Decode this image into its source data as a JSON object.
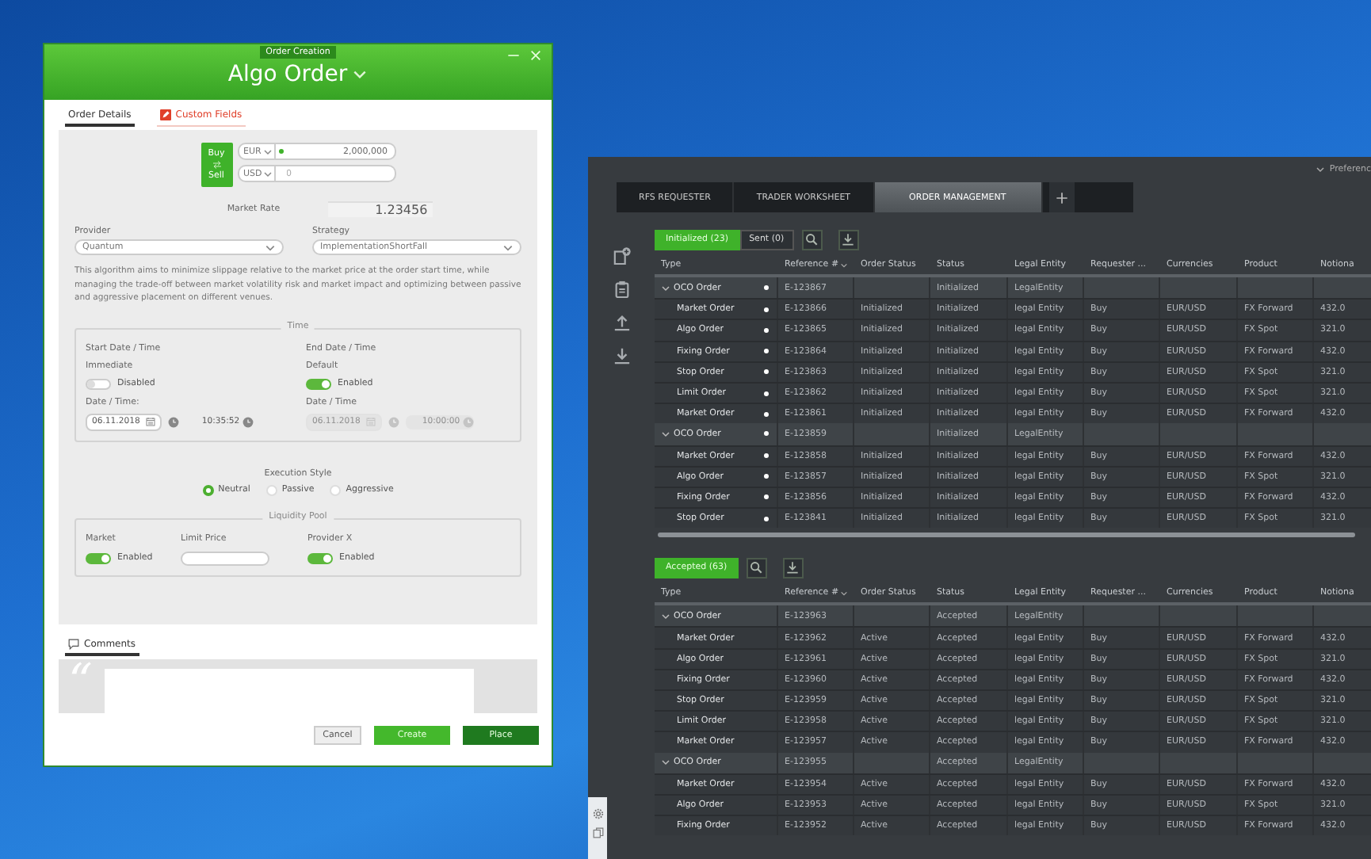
{
  "dialog": {
    "badge": "Order Creation",
    "title": "Algo Order",
    "tabs": [
      {
        "label": "Order Details",
        "selected": true,
        "kind": "plain"
      },
      {
        "label": "Custom Fields",
        "selected": false,
        "kind": "flagged"
      }
    ],
    "buy_sell": {
      "top": "Buy",
      "bottom": "Sell"
    },
    "currencies": [
      {
        "code": "EUR",
        "value": "2,000,000",
        "active": true
      },
      {
        "code": "USD",
        "placeholder": "0",
        "active": false
      }
    ],
    "market_rate": {
      "label": "Market Rate",
      "value": "1.23456"
    },
    "selects": [
      {
        "label": "Provider",
        "value": "Quantum"
      },
      {
        "label": "Strategy",
        "value": "ImplementationShortFall"
      }
    ],
    "description": "This algorithm aims to minimize slippage relative to the market price at the order start time, while managing the trade-off between market volatility risk and market impact and optimizing between passive and aggressive placement on different venues.",
    "time": {
      "legend": "Time",
      "columns": [
        {
          "heading": "Start Date / Time",
          "mode": "Immediate",
          "toggle_on": false,
          "toggle_label": "Disabled",
          "datetime_label": "Date / Time:",
          "date": "06.11.2018",
          "time": "10:35:52",
          "disabled": false
        },
        {
          "heading": "End Date / Time",
          "mode": "Default",
          "toggle_on": true,
          "toggle_label": "Enabled",
          "datetime_label": "Date / Time",
          "date": "06.11.2018",
          "time": "10:00:00",
          "disabled": true
        }
      ]
    },
    "execution_style": {
      "label": "Execution Style",
      "options": [
        {
          "label": "Neutral",
          "selected": true
        },
        {
          "label": "Passive",
          "selected": false
        },
        {
          "label": "Aggressive",
          "selected": false
        }
      ]
    },
    "liquidity_pool": {
      "legend": "Liquidity Pool",
      "items": [
        {
          "kind": "toggle",
          "label": "Market",
          "on": true,
          "state_label": "Enabled"
        },
        {
          "kind": "field",
          "label": "Limit Price"
        },
        {
          "kind": "toggle",
          "label": "Provider X",
          "on": true,
          "state_label": "Enabled"
        }
      ]
    },
    "comments": {
      "tab": "Comments",
      "quote": "“"
    },
    "buttons": [
      {
        "label": "Cancel",
        "kind": "secondary"
      },
      {
        "label": "Create",
        "kind": "primary"
      },
      {
        "label": "Place",
        "kind": "confirm"
      }
    ]
  },
  "window": {
    "preferences": "Preferenc",
    "tabs": [
      {
        "label": "RFS REQUESTER",
        "selected": false
      },
      {
        "label": "TRADER WORKSHEET",
        "selected": false
      },
      {
        "label": "ORDER MANAGEMENT",
        "selected": true
      }
    ],
    "tables": [
      {
        "filters": [
          {
            "label": "Initialized (23)",
            "selected": true
          },
          {
            "label": "Sent (0)",
            "selected": false
          }
        ],
        "columns": [
          {
            "label": "Type",
            "sorted": false
          },
          {
            "label": "Reference #",
            "sorted": true
          },
          {
            "label": "Order Status",
            "sorted": false
          },
          {
            "label": "Status",
            "sorted": false
          },
          {
            "label": "Legal Entity",
            "sorted": false
          },
          {
            "label": "Requester ...",
            "sorted": false
          },
          {
            "label": "Currencies",
            "sorted": false
          },
          {
            "label": "Product",
            "sorted": false
          },
          {
            "label": "Notiona",
            "sorted": false
          }
        ],
        "rows": [
          {
            "type": "OCO Order",
            "expanded": true,
            "marked": true,
            "reference": "E-123867",
            "status": "Initialized",
            "legal_entity": "LegalEntity",
            "children": [
              {
                "type": "Market Order",
                "marked": true,
                "reference": "E-123866",
                "order_status": "Initialized",
                "status": "Initialized",
                "legal_entity": "legal Entity",
                "requester": "Buy",
                "currencies": "EUR/USD",
                "product": "FX Forward",
                "notional": "432.0"
              },
              {
                "type": "Algo Order",
                "marked": true,
                "reference": "E-123865",
                "order_status": "Initialized",
                "status": "Initialized",
                "legal_entity": "legal Entity",
                "requester": "Buy",
                "currencies": "EUR/USD",
                "product": "FX Spot",
                "notional": "321.0"
              },
              {
                "type": "Fixing Order",
                "marked": true,
                "reference": "E-123864",
                "order_status": "Initialized",
                "status": "Initialized",
                "legal_entity": "legal Entity",
                "requester": "Buy",
                "currencies": "EUR/USD",
                "product": "FX Forward",
                "notional": "432.0"
              },
              {
                "type": "Stop Order",
                "marked": true,
                "reference": "E-123863",
                "order_status": "Initialized",
                "status": "Initialized",
                "legal_entity": "legal Entity",
                "requester": "Buy",
                "currencies": "EUR/USD",
                "product": "FX Spot",
                "notional": "321.0"
              },
              {
                "type": "Limit Order",
                "marked": true,
                "reference": "E-123862",
                "order_status": "Initialized",
                "status": "Initialized",
                "legal_entity": "legal Entity",
                "requester": "Buy",
                "currencies": "EUR/USD",
                "product": "FX Spot",
                "notional": "321.0"
              },
              {
                "type": "Market Order",
                "marked": true,
                "reference": "E-123861",
                "order_status": "Initialized",
                "status": "Initialized",
                "legal_entity": "legal Entity",
                "requester": "Buy",
                "currencies": "EUR/USD",
                "product": "FX Forward",
                "notional": "432.0"
              }
            ]
          },
          {
            "type": "OCO Order",
            "expanded": true,
            "marked": true,
            "reference": "E-123859",
            "status": "Initialized",
            "legal_entity": "LegalEntity",
            "children": [
              {
                "type": "Market Order",
                "marked": true,
                "reference": "E-123858",
                "order_status": "Initialized",
                "status": "Initialized",
                "legal_entity": "legal Entity",
                "requester": "Buy",
                "currencies": "EUR/USD",
                "product": "FX Forward",
                "notional": "432.0"
              },
              {
                "type": "Algo Order",
                "marked": true,
                "reference": "E-123857",
                "order_status": "Initialized",
                "status": "Initialized",
                "legal_entity": "legal Entity",
                "requester": "Buy",
                "currencies": "EUR/USD",
                "product": "FX Spot",
                "notional": "321.0"
              },
              {
                "type": "Fixing Order",
                "marked": true,
                "reference": "E-123856",
                "order_status": "Initialized",
                "status": "Initialized",
                "legal_entity": "legal Entity",
                "requester": "Buy",
                "currencies": "EUR/USD",
                "product": "FX Forward",
                "notional": "432.0"
              },
              {
                "type": "Stop Order",
                "marked": true,
                "reference": "E-123841",
                "order_status": "Initialized",
                "status": "Initialized",
                "legal_entity": "legal Entity",
                "requester": "Buy",
                "currencies": "EUR/USD",
                "product": "FX Spot",
                "notional": "321.0"
              }
            ]
          }
        ]
      },
      {
        "filters": [
          {
            "label": "Accepted (63)",
            "selected": true
          }
        ],
        "columns": [
          {
            "label": "Type",
            "sorted": false
          },
          {
            "label": "Reference #",
            "sorted": true
          },
          {
            "label": "Order Status",
            "sorted": false
          },
          {
            "label": "Status",
            "sorted": false
          },
          {
            "label": "Legal Entity",
            "sorted": false
          },
          {
            "label": "Requester ...",
            "sorted": false
          },
          {
            "label": "Currencies",
            "sorted": false
          },
          {
            "label": "Product",
            "sorted": false
          },
          {
            "label": "Notiona",
            "sorted": false
          }
        ],
        "rows": [
          {
            "type": "OCO Order",
            "expanded": true,
            "reference": "E-123963",
            "status": "Accepted",
            "legal_entity": "LegalEntity",
            "children": [
              {
                "type": "Market Order",
                "reference": "E-123962",
                "order_status": "Active",
                "status": "Accepted",
                "legal_entity": "legal Entity",
                "requester": "Buy",
                "currencies": "EUR/USD",
                "product": "FX Forward",
                "notional": "432.0"
              },
              {
                "type": "Algo Order",
                "reference": "E-123961",
                "order_status": "Active",
                "status": "Accepted",
                "legal_entity": "legal Entity",
                "requester": "Buy",
                "currencies": "EUR/USD",
                "product": "FX Spot",
                "notional": "321.0"
              },
              {
                "type": "Fixing Order",
                "reference": "E-123960",
                "order_status": "Active",
                "status": "Accepted",
                "legal_entity": "legal Entity",
                "requester": "Buy",
                "currencies": "EUR/USD",
                "product": "FX Forward",
                "notional": "432.0"
              },
              {
                "type": "Stop Order",
                "reference": "E-123959",
                "order_status": "Active",
                "status": "Accepted",
                "legal_entity": "legal Entity",
                "requester": "Buy",
                "currencies": "EUR/USD",
                "product": "FX Spot",
                "notional": "321.0"
              },
              {
                "type": "Limit Order",
                "reference": "E-123958",
                "order_status": "Active",
                "status": "Accepted",
                "legal_entity": "legal Entity",
                "requester": "Buy",
                "currencies": "EUR/USD",
                "product": "FX Spot",
                "notional": "321.0"
              },
              {
                "type": "Market Order",
                "reference": "E-123957",
                "order_status": "Active",
                "status": "Accepted",
                "legal_entity": "legal Entity",
                "requester": "Buy",
                "currencies": "EUR/USD",
                "product": "FX Forward",
                "notional": "432.0"
              }
            ]
          },
          {
            "type": "OCO Order",
            "expanded": true,
            "reference": "E-123955",
            "status": "Accepted",
            "legal_entity": "LegalEntity",
            "children": [
              {
                "type": "Market Order",
                "reference": "E-123954",
                "order_status": "Active",
                "status": "Accepted",
                "legal_entity": "legal Entity",
                "requester": "Buy",
                "currencies": "EUR/USD",
                "product": "FX Forward",
                "notional": "432.0"
              },
              {
                "type": "Algo Order",
                "reference": "E-123953",
                "order_status": "Active",
                "status": "Accepted",
                "legal_entity": "legal Entity",
                "requester": "Buy",
                "currencies": "EUR/USD",
                "product": "FX Spot",
                "notional": "321.0"
              },
              {
                "type": "Fixing Order",
                "reference": "E-123952",
                "order_status": "Active",
                "status": "Accepted",
                "legal_entity": "legal Entity",
                "requester": "Buy",
                "currencies": "EUR/USD",
                "product": "FX Forward",
                "notional": "432.0"
              }
            ]
          }
        ]
      }
    ]
  }
}
